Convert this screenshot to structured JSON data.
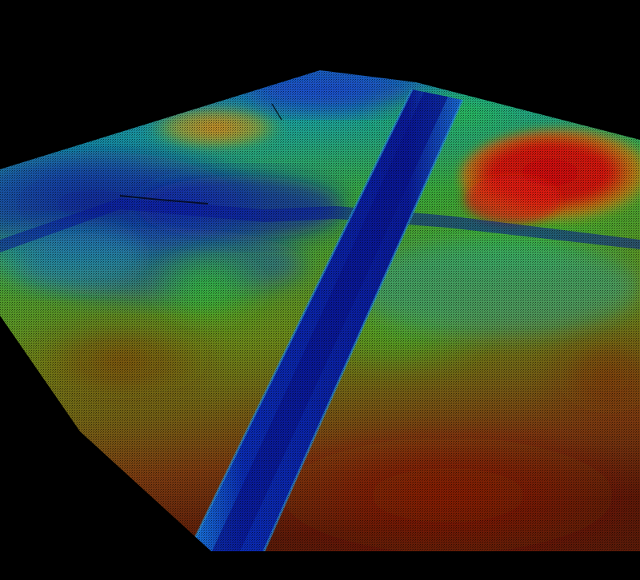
{
  "scene": {
    "kind": "terrain-point-cloud",
    "colormap": "elevation-jet",
    "background_color": "#000000",
    "palette": {
      "low": "#0a1a8a",
      "low_mid": "#1560d0",
      "mid": "#1aa8a0",
      "mid_high": "#3ac83a",
      "high": "#b0a020",
      "peak": "#d81818"
    },
    "features": [
      "channel-blue",
      "mound-red",
      "crossing-road",
      "ridge-orange"
    ]
  }
}
